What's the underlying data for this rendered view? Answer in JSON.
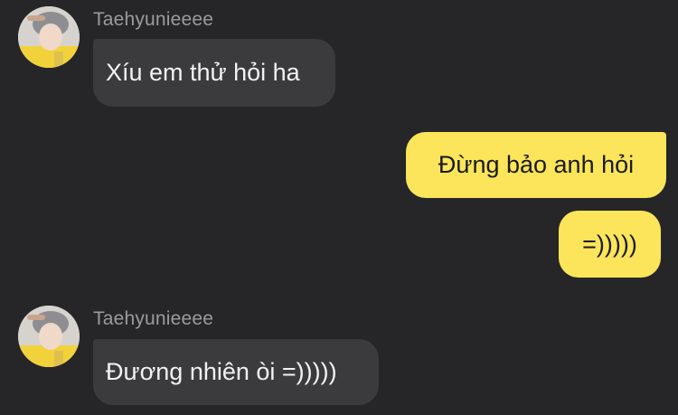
{
  "messages": [
    {
      "direction": "incoming",
      "sender": "Taehyunieeee",
      "text": "Xíu em thử hỏi ha"
    },
    {
      "direction": "outgoing",
      "text": "Đừng bảo anh hỏi"
    },
    {
      "direction": "outgoing",
      "text": "=)))))"
    },
    {
      "direction": "incoming",
      "sender": "Taehyunieeee",
      "text": "Đương nhiên òi =)))))"
    }
  ],
  "colors": {
    "background": "#262628",
    "incoming_bubble": "#3b3b3d",
    "outgoing_bubble": "#fce55a",
    "sender_name": "#9b9b9e"
  }
}
